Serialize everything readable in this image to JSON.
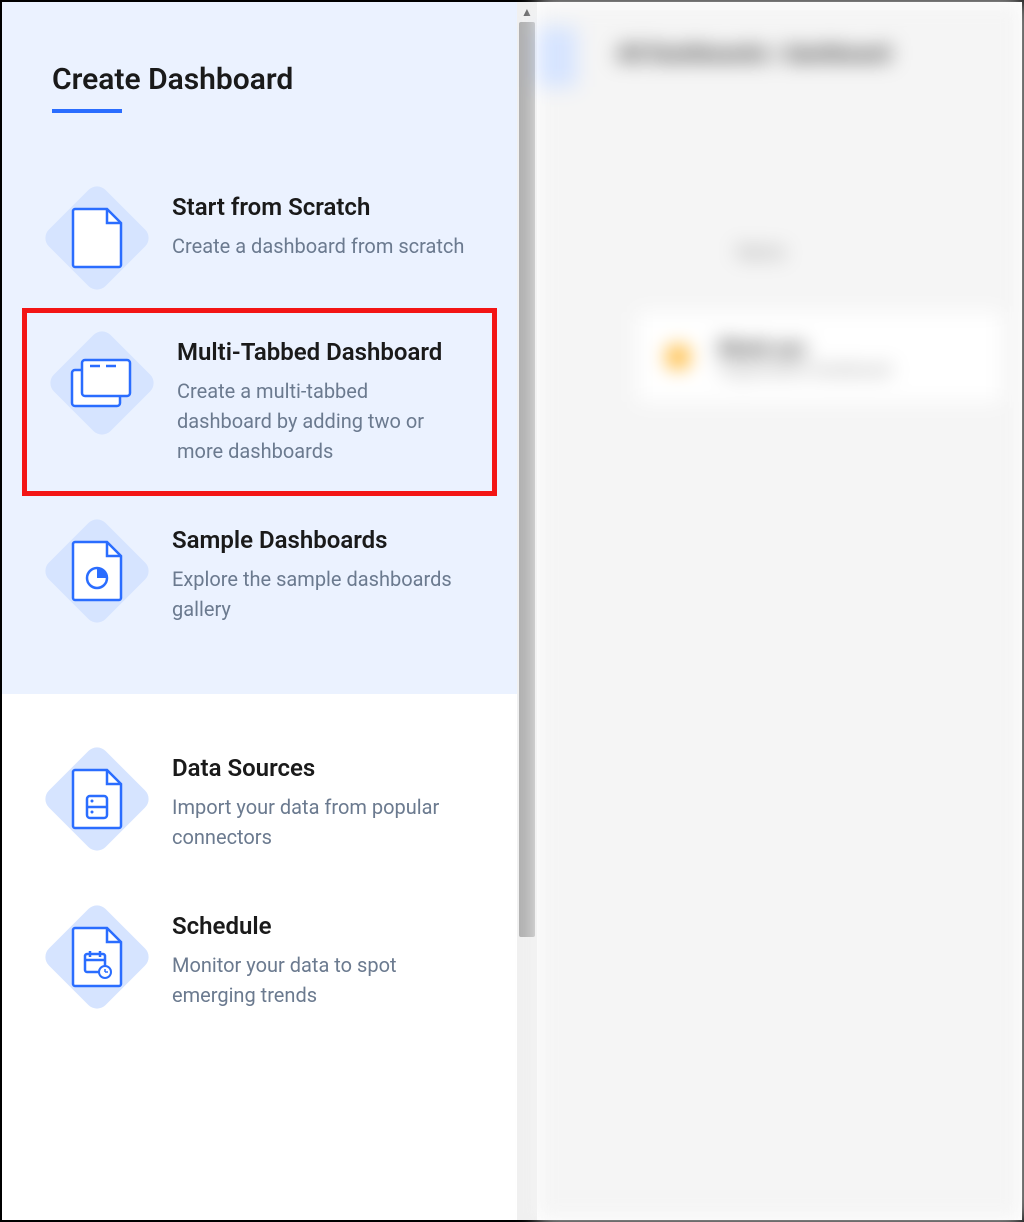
{
  "sidebar": {
    "title": "Create Dashboard",
    "options": [
      {
        "title": "Start from Scratch",
        "description": "Create a dashboard from scratch",
        "icon": "blank-file-icon"
      },
      {
        "title": "Multi-Tabbed Dashboard",
        "description": "Create a multi-tabbed dashboard by adding two or more dashboards",
        "icon": "folders-icon",
        "highlighted": true
      },
      {
        "title": "Sample Dashboards",
        "description": "Explore the sample dashboards gallery",
        "icon": "chart-file-icon"
      },
      {
        "title": "Data Sources",
        "description": "Import your data from popular connectors",
        "icon": "database-file-icon"
      },
      {
        "title": "Schedule",
        "description": "Monitor your data to spot emerging trends",
        "icon": "calendar-file-icon"
      }
    ]
  },
  "main": {
    "breadcrumb": "All Dashboards / dashboard",
    "column_label": "Name",
    "item_title": "Blank.xyz",
    "item_subtitle": "Organization Dashboard"
  }
}
